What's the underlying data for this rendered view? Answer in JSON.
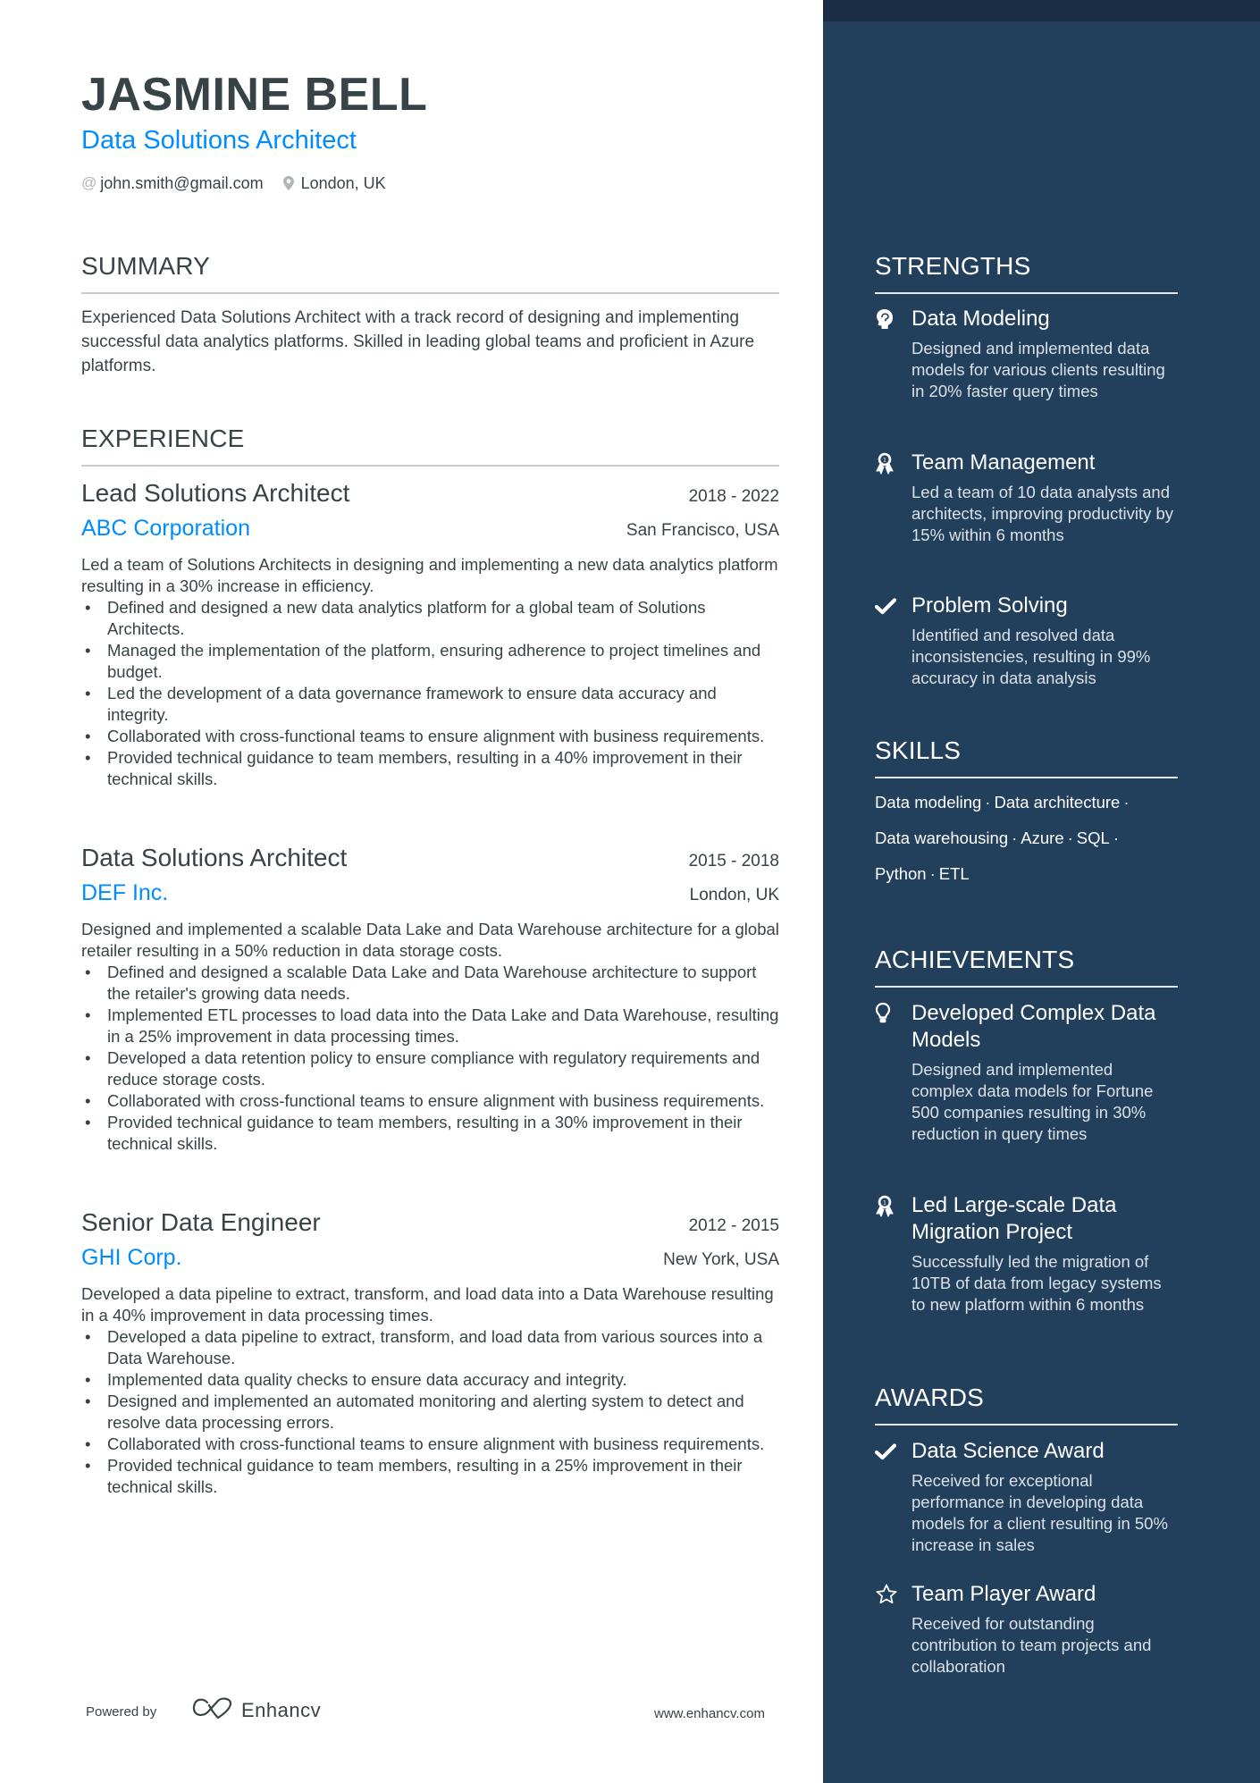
{
  "header": {
    "name": "JASMINE BELL",
    "title": "Data Solutions Architect",
    "email": "john.smith@gmail.com",
    "location": "London, UK",
    "email_icon": "at-icon",
    "location_icon": "map-pin-icon"
  },
  "colors": {
    "accent": "#008cff",
    "text": "#384347",
    "sidebar_bg": "#223f5c",
    "sidebar_topbar": "#1a2d44"
  },
  "summary": {
    "heading": "SUMMARY",
    "text": "Experienced Data Solutions Architect with a track record of designing and implementing successful data analytics platforms. Skilled in leading global teams and proficient in Azure platforms."
  },
  "experience": {
    "heading": "EXPERIENCE",
    "jobs": [
      {
        "role": "Lead Solutions Architect",
        "dates": "2018 - 2022",
        "company": "ABC Corporation",
        "location": "San Francisco, USA",
        "description": "Led a team of Solutions Architects in designing and implementing a new data analytics platform resulting in a 30% increase in efficiency.",
        "bullets": [
          "Defined and designed a new data analytics platform for a global team of Solutions Architects.",
          "Managed the implementation of the platform, ensuring adherence to project timelines and budget.",
          "Led the development of a data governance framework to ensure data accuracy and integrity.",
          "Collaborated with cross-functional teams to ensure alignment with business requirements.",
          "Provided technical guidance to team members, resulting in a 40% improvement in their technical skills."
        ]
      },
      {
        "role": "Data Solutions Architect",
        "dates": "2015 - 2018",
        "company": "DEF Inc.",
        "location": "London, UK",
        "description": "Designed and implemented a scalable Data Lake and Data Warehouse architecture for a global retailer resulting in a 50% reduction in data storage costs.",
        "bullets": [
          "Defined and designed a scalable Data Lake and Data Warehouse architecture to support the retailer's growing data needs.",
          "Implemented ETL processes to load data into the Data Lake and Data Warehouse, resulting in a 25% improvement in data processing times.",
          "Developed a data retention policy to ensure compliance with regulatory requirements and reduce storage costs.",
          "Collaborated with cross-functional teams to ensure alignment with business requirements.",
          "Provided technical guidance to team members, resulting in a 30% improvement in their technical skills."
        ]
      },
      {
        "role": "Senior Data Engineer",
        "dates": "2012 - 2015",
        "company": "GHI Corp.",
        "location": "New York, USA",
        "description": "Developed a data pipeline to extract, transform, and load data into a Data Warehouse resulting in a 40% improvement in data processing times.",
        "bullets": [
          "Developed a data pipeline to extract, transform, and load data from various sources into a Data Warehouse.",
          "Implemented data quality checks to ensure data accuracy and integrity.",
          "Designed and implemented an automated monitoring and alerting system to detect and resolve data processing errors.",
          "Collaborated with cross-functional teams to ensure alignment with business requirements.",
          "Provided technical guidance to team members, resulting in a 25% improvement in their technical skills."
        ]
      }
    ]
  },
  "strengths": {
    "heading": "STRENGTHS",
    "items": [
      {
        "icon": "brain-head-icon",
        "title": "Data Modeling",
        "description": "Designed and implemented data models for various clients resulting in 20% faster query times"
      },
      {
        "icon": "award-ribbon-icon",
        "title": "Team Management",
        "description": "Led a team of 10 data analysts and architects, improving productivity by 15% within 6 months"
      },
      {
        "icon": "checkmark-icon",
        "title": "Problem Solving",
        "description": "Identified and resolved data inconsistencies, resulting in 99% accuracy in data analysis"
      }
    ]
  },
  "skills": {
    "heading": "SKILLS",
    "items": [
      "Data modeling",
      "Data architecture",
      "Data warehousing",
      "Azure",
      "SQL",
      "Python",
      "ETL"
    ],
    "separator": "·"
  },
  "achievements": {
    "heading": "ACHIEVEMENTS",
    "items": [
      {
        "icon": "lightbulb-icon",
        "title": "Developed Complex Data Models",
        "description": "Designed and implemented complex data models for Fortune 500 companies resulting in 30% reduction in query times"
      },
      {
        "icon": "award-ribbon-icon",
        "title": "Led Large-scale Data Migration Project",
        "description": "Successfully led the migration of 10TB of data from legacy systems to new platform within 6 months"
      }
    ]
  },
  "awards": {
    "heading": "AWARDS",
    "items": [
      {
        "icon": "checkmark-icon",
        "title": "Data Science Award",
        "description": "Received for exceptional performance in developing data models for a client resulting in 50% increase in sales"
      },
      {
        "icon": "star-outline-icon",
        "title": "Team Player Award",
        "description": "Received for outstanding contribution to team projects and collaboration"
      }
    ]
  },
  "footer": {
    "powered_by": "Powered by",
    "brand": "Enhancv",
    "url": "www.enhancv.com"
  }
}
